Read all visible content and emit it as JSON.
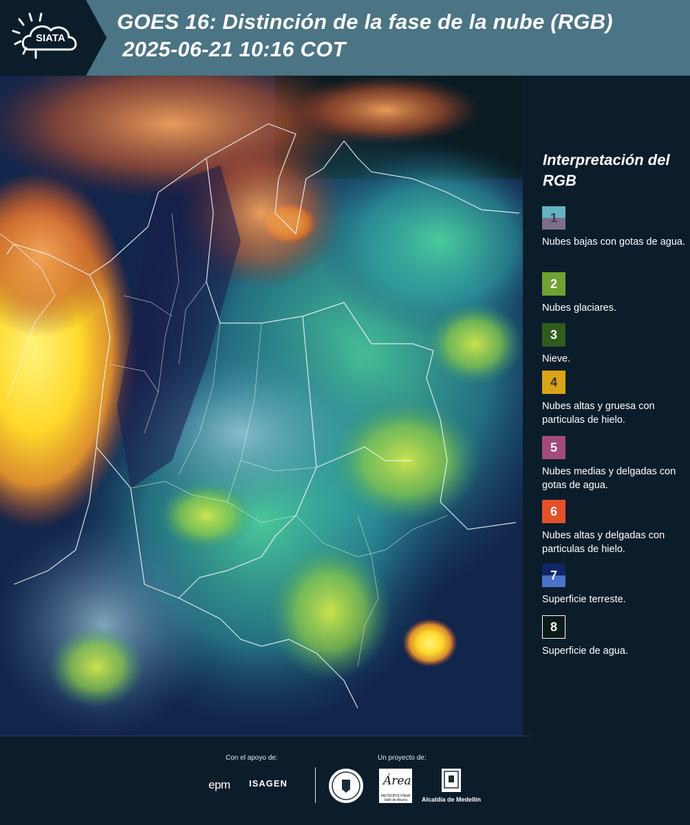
{
  "header": {
    "logo_text": "SIATA",
    "title_line1": "GOES 16: Distinción de la fase de la nube (RGB)",
    "title_line2": "2025-06-21 10:16 COT"
  },
  "legend": {
    "title": "Interpretación del RGB",
    "items": [
      {
        "number": "1",
        "label": "Nubes bajas con gotas de agua.",
        "color_top": "#63b3c4",
        "color_bottom": "#7c6f8a"
      },
      {
        "number": "2",
        "label": "Nubes glaciares.",
        "color": "#6fa232"
      },
      {
        "number": "3",
        "label": "Nieve.",
        "color": "#2f5c1d"
      },
      {
        "number": "4",
        "label": "Nubes altas y gruesa con particulas de hielo.",
        "color": "#d9a418"
      },
      {
        "number": "5",
        "label": "Nubes medias y delgadas con gotas de agua.",
        "color": "#a24a7b"
      },
      {
        "number": "6",
        "label": "Nubes altas y delgadas con particulas de hielo.",
        "color": "#e3502a"
      },
      {
        "number": "7",
        "label": "Superficie terreste.",
        "color_top": "#0f2566",
        "color_bottom": "#4a72c8"
      },
      {
        "number": "8",
        "label": "Superficie de agua.",
        "color": "#0b1b17"
      }
    ]
  },
  "footer": {
    "support_label": "Con el apoyo de:",
    "project_label": "Un proyecto de:",
    "sponsor_1": "epm",
    "sponsor_2": "ISAGEN",
    "partner_area_big": "Área",
    "partner_area_small": "METROPOLITANA Valle de Aburrá",
    "partner_3": "Alcaldía de Medellín"
  },
  "colors": {
    "header_bg": "#4b7484",
    "panel_bg": "#0b1d2a"
  }
}
